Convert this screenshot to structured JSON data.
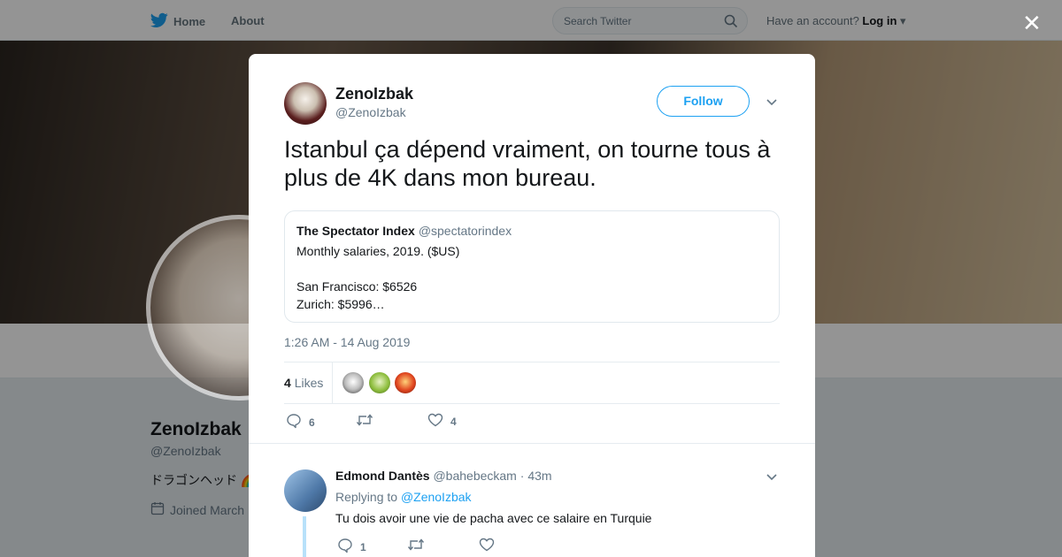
{
  "nav": {
    "home": "Home",
    "about": "About",
    "search_placeholder": "Search Twitter",
    "account_prompt": "Have an account?",
    "login": "Log in"
  },
  "background_profile": {
    "name": "ZenoIzbak",
    "handle": "@ZenoIzbak",
    "bio": "ドラゴンヘッド 🌈",
    "joined": "Joined March"
  },
  "tweet": {
    "author_name": "ZenoIzbak",
    "author_handle": "@ZenoIzbak",
    "follow_label": "Follow",
    "text": "Istanbul ça dépend vraiment, on tourne tous à plus de 4K dans mon bureau.",
    "quote": {
      "name": "The Spectator Index",
      "handle": "@spectatorindex",
      "lines": [
        "Monthly salaries, 2019. ($US)",
        "",
        "San Francisco: $6526",
        "Zurich: $5996…"
      ]
    },
    "timestamp": "1:26 AM - 14 Aug 2019",
    "likes_count": "4",
    "likes_label": "Likes",
    "reply_count": "6",
    "like_count": "4"
  },
  "reply": {
    "name": "Edmond Dantès",
    "handle": "@bahebeckam",
    "separator": "·",
    "time": "43m",
    "replying_prefix": "Replying to",
    "replying_to": "@ZenoIzbak",
    "text": "Tu dois avoir une vie de pacha avec ce salaire en Turquie",
    "reply_count": "1"
  },
  "colors": {
    "accent": "#1da1f2",
    "like_colors": [
      "#d9d9d9",
      "#8fbf3f",
      "#e0451f"
    ]
  }
}
